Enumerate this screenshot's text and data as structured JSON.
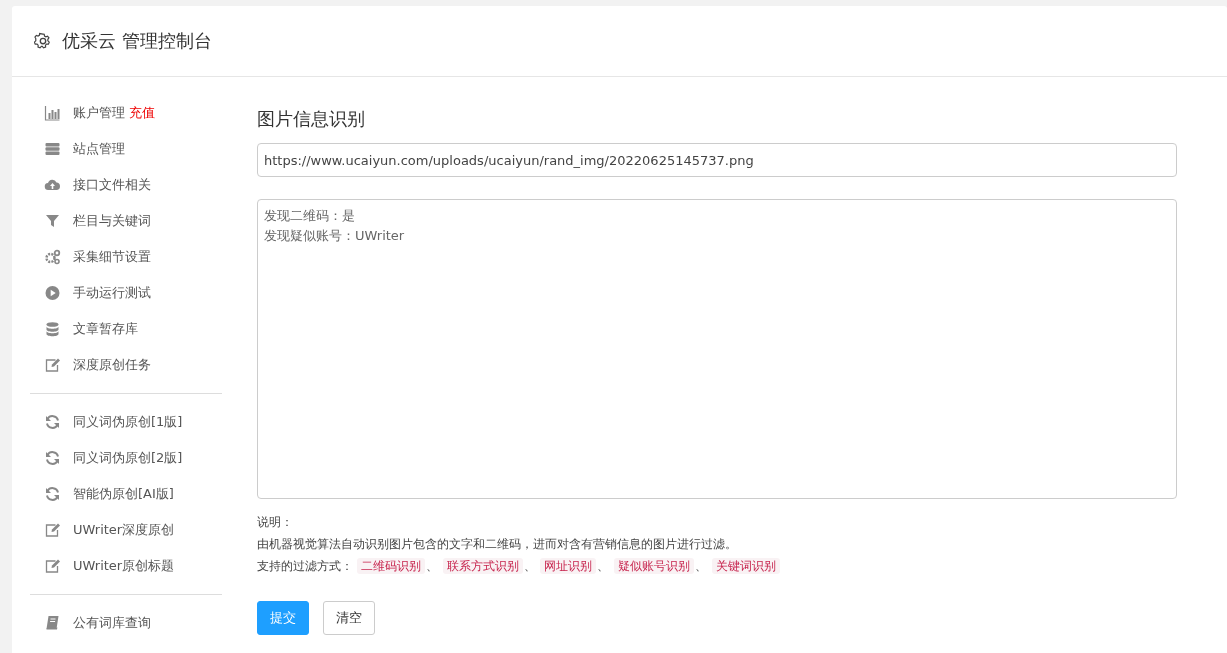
{
  "header": {
    "title": "优采云 管理控制台"
  },
  "sidebar": {
    "groups": [
      {
        "items": [
          {
            "label": "账户管理",
            "badge": "充值"
          },
          {
            "label": "站点管理"
          },
          {
            "label": "接口文件相关"
          },
          {
            "label": "栏目与关键词"
          },
          {
            "label": "采集细节设置"
          },
          {
            "label": "手动运行测试"
          },
          {
            "label": "文章暂存库"
          },
          {
            "label": "深度原创任务"
          }
        ]
      },
      {
        "items": [
          {
            "label": "同义词伪原创[1版]"
          },
          {
            "label": "同义词伪原创[2版]"
          },
          {
            "label": "智能伪原创[AI版]"
          },
          {
            "label": "UWriter深度原创"
          },
          {
            "label": "UWriter原创标题"
          }
        ]
      },
      {
        "items": [
          {
            "label": "公有词库查询"
          }
        ]
      }
    ]
  },
  "main": {
    "title": "图片信息识别",
    "url_field": {
      "value": "https://www.ucaiyun.com/uploads/ucaiyun/rand_img/20220625145737.png"
    },
    "result_box": {
      "lines": [
        "发现二维码：是",
        "发现疑似账号：UWriter"
      ]
    },
    "notes": {
      "heading": "说明：",
      "description": "由机器视觉算法自动识别图片包含的文字和二维码，进而对含有营销信息的图片进行过滤。",
      "methods_label": "支持的过滤方式：",
      "separator": "、",
      "methods": [
        "二维码识别",
        "联系方式识别",
        "网址识别",
        "疑似账号识别",
        "关键词识别"
      ]
    },
    "buttons": [
      {
        "label": "提交",
        "kind": "primary"
      },
      {
        "label": "清空",
        "kind": "default"
      }
    ]
  }
}
